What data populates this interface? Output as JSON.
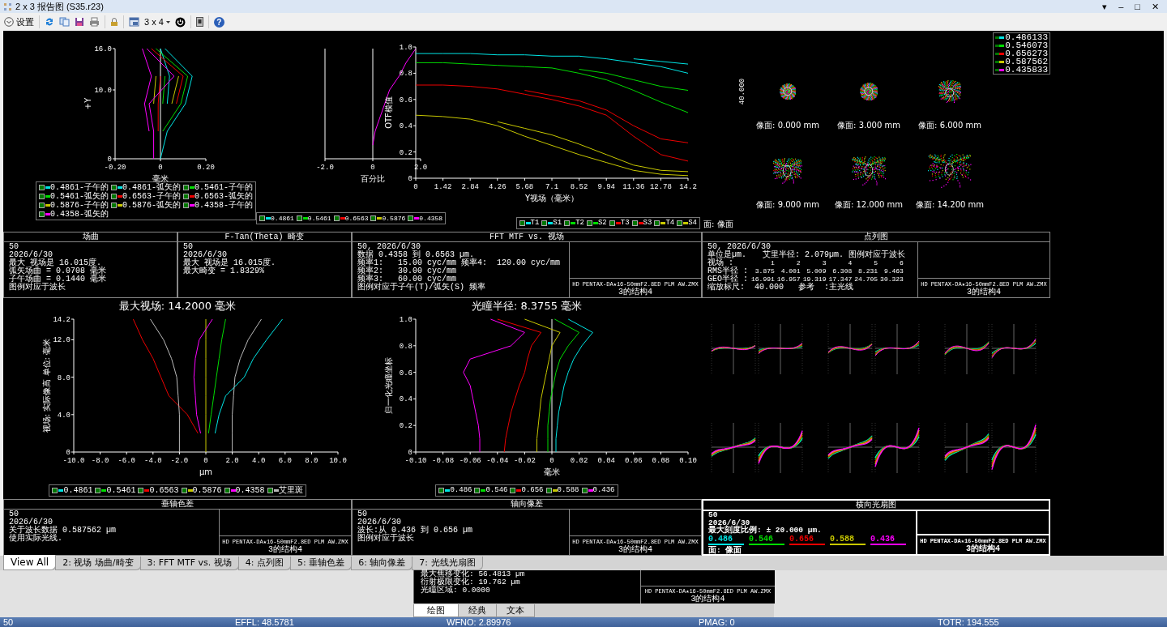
{
  "window": {
    "title": "2 x 3 报告图 (S35.r23)",
    "controls": [
      "▾",
      "–",
      "□",
      "✕"
    ]
  },
  "toolbar": {
    "settings_label": "设置",
    "layout_label": "3 x 4",
    "help_glyph": "?"
  },
  "field_curvature": {
    "chart_data": {
      "type": "line",
      "orientation": "horizontal",
      "xlabel": "毫米",
      "ylabel": "+Y",
      "x": [
        0,
        4,
        8,
        12,
        16
      ],
      "xlim": [
        -0.2,
        0.2
      ],
      "ylim": [
        0,
        16
      ],
      "xticks": [
        {
          "value": -0.2,
          "label": "-0.20"
        },
        {
          "value": 0,
          "label": "0"
        },
        {
          "value": 0.2,
          "label": "0.20"
        }
      ],
      "yticks": [
        {
          "value": 0,
          "label": "0"
        },
        {
          "value": 10,
          "label": "10.0"
        },
        {
          "value": 16,
          "label": "16.0"
        }
      ],
      "series": [
        {
          "name": "0.4861-子午的",
          "color": "#00e5e5",
          "values": [
            0,
            0.03,
            0.11,
            0.14,
            0.02
          ]
        },
        {
          "name": "0.4861-弧矢的",
          "color": "#00e5e5",
          "values": [
            null,
            null,
            0.03,
            0.04,
            0.0
          ]
        },
        {
          "name": "0.5461-子午的",
          "color": "#00dd00",
          "values": [
            null,
            0.01,
            0.09,
            0.12,
            -0.02
          ]
        },
        {
          "name": "0.5461-弧矢的",
          "color": "#00dd00",
          "values": [
            null,
            null,
            0.01,
            0.02,
            null
          ]
        },
        {
          "name": "0.6563-子午的",
          "color": "#ee0000",
          "values": [
            null,
            null,
            0.07,
            0.1,
            -0.04
          ]
        },
        {
          "name": "0.6563-弧矢的",
          "color": "#ee0000",
          "values": [
            null,
            -0.01,
            -0.01,
            0.0,
            null
          ]
        },
        {
          "name": "0.5876-子午的",
          "color": "#c8c800",
          "values": [
            null,
            null,
            0.05,
            0.08,
            null
          ]
        },
        {
          "name": "0.5876-弧矢的",
          "color": "#c8c800",
          "values": [
            null,
            null,
            -0.03,
            -0.02,
            null
          ]
        },
        {
          "name": "0.4358-子午的",
          "color": "#ff00ff",
          "values": [
            -0.03,
            -0.03,
            -0.05,
            0.06,
            -0.06
          ]
        },
        {
          "name": "0.4358-弧矢的",
          "color": "#ff00ff",
          "values": [
            null,
            -0.05,
            -0.07,
            -0.04,
            -0.08
          ]
        }
      ]
    }
  },
  "distortion": {
    "chart_data": {
      "type": "line",
      "orientation": "horizontal",
      "xlabel": "百分比",
      "xlim": [
        -2,
        2
      ],
      "xticks": [
        {
          "value": -2,
          "label": "-2.0"
        },
        {
          "value": 0,
          "label": "0"
        },
        {
          "value": 2,
          "label": "2.0"
        }
      ],
      "series": [
        {
          "color": "#ff00ff",
          "values": [
            1.8,
            1.4,
            1.1,
            0.7,
            0.5,
            0.3,
            0.1,
            0.0,
            null
          ]
        }
      ]
    },
    "legend": [
      {
        "label": "0.4861",
        "color": "#00e5e5"
      },
      {
        "label": "0.5461",
        "color": "#00dd00"
      },
      {
        "label": "0.6563",
        "color": "#ee0000"
      },
      {
        "label": "0.5876",
        "color": "#c8c800"
      },
      {
        "label": "0.4358",
        "color": "#ff00ff"
      }
    ]
  },
  "mtf": {
    "chart_data": {
      "type": "line",
      "xlabel": "Y视场（毫米）",
      "ylabel": "OTF模值",
      "x": [
        0,
        1.42,
        2.84,
        4.26,
        5.68,
        7.1,
        8.52,
        9.94,
        11.36,
        12.78,
        14.2
      ],
      "xlim": [
        0,
        14.2
      ],
      "ylim": [
        0,
        1
      ],
      "xticks": [
        {
          "value": 0,
          "label": "0"
        },
        {
          "value": 1.42,
          "label": "1.42"
        },
        {
          "value": 2.84,
          "label": "2.84"
        },
        {
          "value": 4.26,
          "label": "4.26"
        },
        {
          "value": 5.68,
          "label": "5.68"
        },
        {
          "value": 7.1,
          "label": "7.1"
        },
        {
          "value": 8.52,
          "label": "8.52"
        },
        {
          "value": 9.94,
          "label": "9.94"
        },
        {
          "value": 11.36,
          "label": "11.36"
        },
        {
          "value": 12.78,
          "label": "12.78"
        },
        {
          "value": 14.2,
          "label": "14.2"
        }
      ],
      "yticks": [
        {
          "value": 0,
          "label": "0"
        },
        {
          "value": 0.2,
          "label": "0.2"
        },
        {
          "value": 0.4,
          "label": "0.4"
        },
        {
          "value": 0.6,
          "label": "0.6"
        },
        {
          "value": 0.8,
          "label": "0.8"
        },
        {
          "value": 1,
          "label": "1.0"
        }
      ],
      "series": [
        {
          "name": "T1",
          "color": "#00e5e5",
          "values": [
            0.95,
            0.95,
            0.95,
            0.94,
            0.94,
            0.93,
            0.93,
            0.91,
            0.88,
            0.85,
            0.8
          ]
        },
        {
          "name": "S1",
          "color": "#00e5e5",
          "values": [
            null,
            null,
            null,
            null,
            null,
            null,
            null,
            null,
            0.91,
            0.89,
            0.87
          ]
        },
        {
          "name": "T2",
          "color": "#00dd00",
          "values": [
            0.88,
            0.88,
            0.87,
            0.86,
            0.85,
            0.84,
            0.8,
            0.75,
            0.67,
            0.58,
            0.5
          ]
        },
        {
          "name": "S2",
          "color": "#00dd00",
          "values": [
            null,
            null,
            null,
            null,
            null,
            null,
            0.83,
            0.8,
            0.75,
            0.7,
            0.67
          ]
        },
        {
          "name": "T3",
          "color": "#ee0000",
          "values": [
            0.71,
            0.71,
            0.7,
            0.68,
            0.64,
            0.6,
            0.55,
            0.48,
            0.32,
            0.18,
            0.13
          ]
        },
        {
          "name": "S3",
          "color": "#ee0000",
          "values": [
            null,
            null,
            null,
            null,
            0.67,
            0.63,
            0.59,
            0.52,
            0.4,
            0.3,
            0.27
          ]
        },
        {
          "name": "T4",
          "color": "#c8c800",
          "values": [
            0.48,
            0.47,
            0.45,
            0.4,
            0.32,
            0.25,
            0.18,
            0.12,
            0.06,
            0.03,
            0.02
          ]
        },
        {
          "name": "S4",
          "color": "#c8c800",
          "values": [
            null,
            null,
            null,
            0.43,
            0.38,
            0.33,
            0.26,
            0.18,
            0.1,
            0.06,
            0.05
          ]
        }
      ]
    }
  },
  "spot_diagram": {
    "legend": [
      {
        "label": "0.486133",
        "color": "#00e5e5"
      },
      {
        "label": "0.546073",
        "color": "#00dd00"
      },
      {
        "label": "0.656273",
        "color": "#ee0000"
      },
      {
        "label": "0.587562",
        "color": "#c8c800"
      },
      {
        "label": "0.435833",
        "color": "#ff00ff"
      }
    ],
    "scale_label": "40.000",
    "spots": [
      {
        "label": "像面: 0.000 mm"
      },
      {
        "label": "像面: 3.000 mm"
      },
      {
        "label": "像面: 6.000 mm"
      },
      {
        "label": "像面: 9.000 mm"
      },
      {
        "label": "像面: 12.000 mm"
      },
      {
        "label": "像面: 14.200 mm"
      }
    ],
    "surface_label": "面: 像面"
  },
  "lateral_color": {
    "title": "最大视场: 14.2000 毫米",
    "chart_data": {
      "type": "line",
      "orientation": "horizontal",
      "xlabel": "µm",
      "ylabel": "视场: 实际像高 单位: 毫米",
      "x": [
        0,
        2,
        4,
        6,
        8,
        10,
        12,
        14.2
      ],
      "xlim": [
        -10,
        10
      ],
      "ylim": [
        0,
        14.2
      ],
      "xticks": [
        {
          "value": -10,
          "label": "-10.0"
        },
        {
          "value": -8,
          "label": "-8.0"
        },
        {
          "value": -6,
          "label": "-6.0"
        },
        {
          "value": -4,
          "label": "-4.0"
        },
        {
          "value": -2,
          "label": "-2.0"
        },
        {
          "value": 0,
          "label": "0"
        },
        {
          "value": 2,
          "label": "2.0"
        },
        {
          "value": 4,
          "label": "4.0"
        },
        {
          "value": 6,
          "label": "6.0"
        },
        {
          "value": 8,
          "label": "8.0"
        },
        {
          "value": 10,
          "label": "10.0"
        }
      ],
      "yticks": [
        {
          "value": 0,
          "label": "0"
        },
        {
          "value": 4,
          "label": "4.0"
        },
        {
          "value": 8,
          "label": "8.0"
        },
        {
          "value": 12,
          "label": "12.0"
        },
        {
          "value": 14.2,
          "label": "14.2"
        }
      ],
      "series": [
        {
          "name": "0.4861",
          "color": "#00e5e5",
          "values": [
            null,
            0.7,
            1.0,
            1.5,
            2.9,
            3.6,
            4.6,
            5.8
          ]
        },
        {
          "name": "0.5461",
          "color": "#00dd00",
          "values": [
            null,
            0.2,
            0.4,
            0.6,
            0.8,
            1.0,
            1.2,
            1.5
          ]
        },
        {
          "name": "0.6563",
          "color": "#ee0000",
          "values": [
            null,
            -0.6,
            -1.4,
            -2.8,
            -3.4,
            -4.0,
            -4.8,
            -5.5
          ]
        },
        {
          "name": "0.5876",
          "color": "#c8c800",
          "values": [
            0,
            0,
            0,
            0,
            0,
            0,
            0,
            0
          ]
        },
        {
          "name": "0.4358",
          "color": "#ff00ff",
          "values": [
            null,
            -0.4,
            -0.7,
            -0.8,
            -0.9,
            -0.8,
            -0.5,
            0.5
          ]
        },
        {
          "name": "艾里斑",
          "color": "#bbbbbb",
          "values": [
            2.0,
            2.0,
            2.0,
            2.1,
            2.2,
            2.6,
            3.2,
            4.2
          ]
        },
        {
          "color": "#bbbbbb",
          "values": [
            -2.0,
            -2.0,
            -2.0,
            -2.1,
            -2.2,
            -2.6,
            -3.2,
            -4.2
          ]
        }
      ]
    }
  },
  "longitudinal": {
    "title": "光瞳半径: 8.3755 毫米",
    "chart_data": {
      "type": "line",
      "orientation": "horizontal",
      "xlabel": "毫米",
      "ylabel": "归一化光瞳坐标",
      "x": [
        0,
        0.1,
        0.2,
        0.3,
        0.4,
        0.5,
        0.6,
        0.7,
        0.8,
        0.9,
        1.0
      ],
      "xlim": [
        -0.1,
        0.1
      ],
      "ylim": [
        0,
        1
      ],
      "xticks": [
        {
          "value": -0.1,
          "label": "-0.10"
        },
        {
          "value": -0.08,
          "label": "-0.08"
        },
        {
          "value": -0.06,
          "label": "-0.06"
        },
        {
          "value": -0.04,
          "label": "-0.04"
        },
        {
          "value": -0.02,
          "label": "-0.02"
        },
        {
          "value": 0,
          "label": "0"
        },
        {
          "value": 0.02,
          "label": "0.02"
        },
        {
          "value": 0.04,
          "label": "0.04"
        },
        {
          "value": 0.06,
          "label": "0.06"
        },
        {
          "value": 0.08,
          "label": "0.08"
        },
        {
          "value": 0.1,
          "label": "0.10"
        }
      ],
      "yticks": [
        {
          "value": 0,
          "label": "0"
        },
        {
          "value": 0.2,
          "label": "0.2"
        },
        {
          "value": 0.4,
          "label": "0.4"
        },
        {
          "value": 0.6,
          "label": "0.6"
        },
        {
          "value": 0.8,
          "label": "0.8"
        },
        {
          "value": 1,
          "label": "1.0"
        }
      ],
      "series": [
        {
          "name": "0.486",
          "color": "#00e5e5",
          "values": [
            0.003,
            0.003,
            0.004,
            0.005,
            0.007,
            0.009,
            0.012,
            0.016,
            0.022,
            0.03,
            0.012
          ]
        },
        {
          "name": "0.546",
          "color": "#00dd00",
          "values": [
            -0.003,
            -0.003,
            -0.003,
            -0.002,
            -0.001,
            0.001,
            0.003,
            0.006,
            0.012,
            0.02,
            0.002
          ]
        },
        {
          "name": "0.656",
          "color": "#ee0000",
          "values": [
            -0.035,
            -0.034,
            -0.032,
            -0.03,
            -0.027,
            -0.024,
            -0.02,
            -0.018,
            -0.015,
            -0.008,
            -0.04
          ]
        },
        {
          "name": "0.588",
          "color": "#c8c800",
          "values": [
            -0.011,
            -0.011,
            -0.01,
            -0.009,
            -0.008,
            -0.006,
            -0.004,
            -0.002,
            0.0,
            0.006,
            -0.02
          ]
        },
        {
          "name": "0.436",
          "color": "#ff00ff",
          "values": [
            -0.053,
            -0.053,
            -0.054,
            -0.056,
            -0.058,
            -0.06,
            -0.065,
            -0.06,
            -0.03,
            -0.02,
            -0.045
          ]
        }
      ]
    }
  },
  "info_boxes": [
    {
      "kind": "plain",
      "title": "场曲",
      "lines": [
        "50",
        "2026/6/30",
        "最大 视场是 16.015度.",
        "弧矢场曲 = 0.0708 毫米",
        "子午场曲 = 0.1440 毫米",
        "图例对应于波长"
      ]
    },
    {
      "kind": "plain",
      "title": "F-Tan(Theta) 畸变",
      "lines": [
        "50",
        "2026/6/30",
        "最大 视场是 16.015度.",
        "最大畸变 = 1.8329%"
      ]
    },
    {
      "kind": "plain",
      "title": "FFT MTF vs. 视场",
      "lines": [
        "50, 2026/6/30",
        "数据 0.4358 到 0.6563 µm.",
        "频率1:   15.00 cyc/mm 频率4:  120.00 cyc/mm",
        "频率2:   30.00 cyc/mm",
        "频率3:   60.00 cyc/mm",
        "图例对应于子午(T)/弧矢(S) 频率"
      ],
      "side": [
        "HD PENTAX-DA★16-50mmF2.8ED PLM AW.ZMX",
        "3的结构4"
      ]
    },
    {
      "kind": "spot",
      "title": "点列图",
      "lines": [
        "50, 2026/6/30"
      ],
      "pair": [
        "单位是µm.",
        "艾里半径: 2.079µm. 图例对应于波长"
      ],
      "table": [
        {
          "label": "视场 :",
          "values": [
            "1",
            "2",
            "3",
            "4",
            "5",
            "6"
          ]
        },
        {
          "label": "RMS半径 :",
          "values": [
            "3.875",
            "4.001",
            "5.009",
            "6.308",
            "8.231",
            "9.463"
          ]
        },
        {
          "label": "GEO半径 :",
          "values": [
            "16.991",
            "16.957",
            "19.319",
            "17.347",
            "24.705",
            "30.323"
          ]
        }
      ],
      "footer": "缩放标尺:  40.000   参考  :主光线",
      "side": [
        "HD PENTAX-DA★16-50mmF2.8ED PLM AW.ZMX",
        "3的结构4"
      ]
    },
    {
      "kind": "plain",
      "title": "垂轴色差",
      "lines": [
        "50",
        "2026/6/30",
        "关于波长数据 0.587562 µm",
        "使用实际光线."
      ],
      "side": [
        "HD PENTAX-DA★16-50mmF2.8ED PLM AW.ZMX",
        "3的结构4"
      ]
    },
    {
      "kind": "plain",
      "title": "轴向像差",
      "lines": [
        "50",
        "2026/6/30",
        "波长:从 0.436 到 0.656 µm",
        "图例对应于波长"
      ],
      "side": [
        "HD PENTAX-DA★16-50mmF2.8ED PLM AW.ZMX",
        "3的结构4"
      ]
    },
    {
      "kind": "fan",
      "title": "横向光扇图",
      "lines": [
        "50",
        "2026/6/30",
        "最大刻度比例: ± 20.000 µm."
      ],
      "wavelengths": [
        {
          "label": "0.486",
          "color": "#00e5e5"
        },
        {
          "label": "0.546",
          "color": "#00dd00"
        },
        {
          "label": "0.656",
          "color": "#ee0000"
        },
        {
          "label": "0.588",
          "color": "#c8c800"
        },
        {
          "label": "0.436",
          "color": "#ff00ff"
        }
      ],
      "footer": "面: 像面",
      "side": [
        "HD PENTAX-DA★16-50mmF2.8ED PLM AW.ZMX",
        "3的结构4"
      ]
    }
  ],
  "view_tabs": [
    {
      "label": "View All",
      "selected": true
    },
    {
      "label": "2: 视场 场曲/畸变",
      "selected": false
    },
    {
      "label": "3: FFT MTF vs. 视场",
      "selected": false
    },
    {
      "label": "4: 点列图",
      "selected": false
    },
    {
      "label": "5: 垂轴色差",
      "selected": false
    },
    {
      "label": "6: 轴向像差",
      "selected": false
    },
    {
      "label": "7: 光线光扇图",
      "selected": false
    }
  ],
  "lower_panel": {
    "lines": [
      "最大焦移变化: 56.4813 µm",
      "衍射极限变化: 19.762 µm",
      "光瞳区域: 0.0000"
    ],
    "side": [
      "HD PENTAX-DA★16-50mmF2.8ED PLM AW.ZMX",
      "3的结构4"
    ]
  },
  "mode_tabs": [
    {
      "label": "绘图",
      "selected": true
    },
    {
      "label": "经典",
      "selected": false
    },
    {
      "label": "文本",
      "selected": false
    }
  ],
  "status_bar": [
    "50",
    "EFFL: 48.5781",
    "WFNO: 2.89976",
    "PMAG: 0",
    "TOTR: 194.555"
  ]
}
